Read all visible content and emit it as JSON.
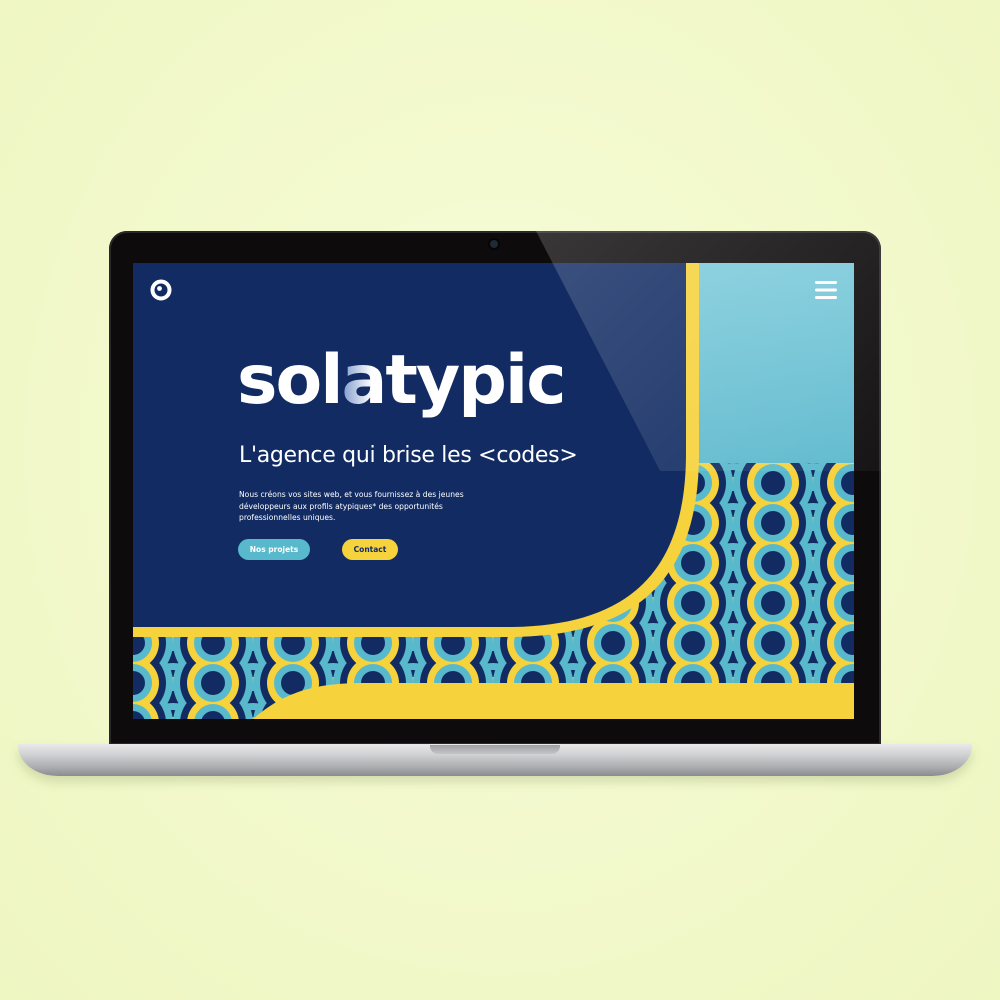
{
  "brand": {
    "before": "sol",
    "split_letter": "a",
    "after": "typic"
  },
  "tagline": "L'agence qui brise les <codes>",
  "description": "Nous créons vos sites web, et vous fournissez à des jeunes développeurs aux profils atypiques* des opportunités professionnelles uniques.",
  "buttons": {
    "projects_label": "Nos projets",
    "contact_label": "Contact"
  },
  "icons": {
    "logo": "ring-logo-icon",
    "menu": "hamburger-menu-icon"
  },
  "colors": {
    "navy": "#122c63",
    "teal": "#58b9cc",
    "yellow": "#f6d23c",
    "sky": "#73c5d7",
    "background": "#f5fbd0"
  }
}
